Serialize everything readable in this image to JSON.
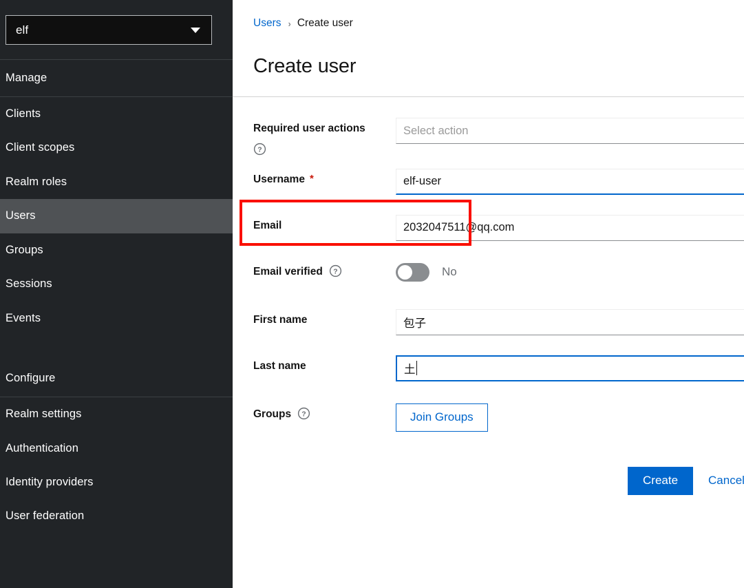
{
  "sidebar": {
    "realm_selector": {
      "value": "elf",
      "caret_icon": "caret-down-icon"
    },
    "sections": [
      {
        "title": "Manage",
        "items": [
          {
            "label": "Clients",
            "active": false
          },
          {
            "label": "Client scopes",
            "active": false
          },
          {
            "label": "Realm roles",
            "active": false
          },
          {
            "label": "Users",
            "active": true
          },
          {
            "label": "Groups",
            "active": false
          },
          {
            "label": "Sessions",
            "active": false
          },
          {
            "label": "Events",
            "active": false
          }
        ]
      },
      {
        "title": "Configure",
        "items": [
          {
            "label": "Realm settings",
            "active": false
          },
          {
            "label": "Authentication",
            "active": false
          },
          {
            "label": "Identity providers",
            "active": false
          },
          {
            "label": "User federation",
            "active": false
          }
        ]
      }
    ]
  },
  "breadcrumb": {
    "parent": "Users",
    "separator": "›",
    "current": "Create user"
  },
  "page": {
    "title": "Create user"
  },
  "form": {
    "required_user_actions": {
      "label": "Required user actions",
      "help_icon": "help-circle-icon",
      "placeholder": "Select action",
      "value": ""
    },
    "username": {
      "label": "Username",
      "required_marker": "*",
      "value": "elf-user"
    },
    "email": {
      "label": "Email",
      "value": "2032047511@qq.com"
    },
    "email_verified": {
      "label": "Email verified",
      "help_icon": "help-circle-icon",
      "state": "off",
      "state_label": "No"
    },
    "first_name": {
      "label": "First name",
      "value": "包子"
    },
    "last_name": {
      "label": "Last name",
      "value": "土",
      "focused": true
    },
    "groups": {
      "label": "Groups",
      "help_icon": "help-circle-icon",
      "join_button": "Join Groups"
    }
  },
  "actions": {
    "create": "Create",
    "cancel": "Cancel"
  },
  "colors": {
    "accent": "#0066cc",
    "sidebar_bg": "#212427",
    "sidebar_active": "#4f5255",
    "annotation": "#fa0f00",
    "required_star": "#c9190b",
    "toggle_off": "#8a8d90"
  }
}
